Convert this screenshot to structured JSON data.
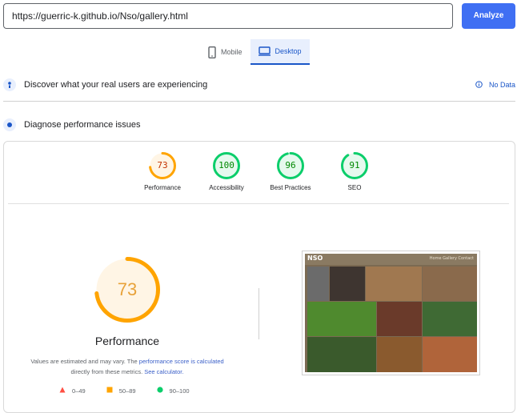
{
  "url_input": {
    "value": "https://guerric-k.github.io/Nso/gallery.html"
  },
  "analyze_button": {
    "label": "Analyze"
  },
  "tabs": [
    {
      "label": "Mobile",
      "active": false
    },
    {
      "label": "Desktop",
      "active": true
    }
  ],
  "field_data": {
    "title": "Discover what your real users are experiencing",
    "status": "No Data"
  },
  "lab_data": {
    "title": "Diagnose performance issues"
  },
  "scores": [
    {
      "label": "Performance",
      "value": "73",
      "color": "#ffa400",
      "fraction": 0.73
    },
    {
      "label": "Accessibility",
      "value": "100",
      "color": "#0cce6b",
      "fraction": 1.0
    },
    {
      "label": "Best Practices",
      "value": "96",
      "color": "#0cce6b",
      "fraction": 0.96
    },
    {
      "label": "SEO",
      "value": "91",
      "color": "#0cce6b",
      "fraction": 0.91
    }
  ],
  "main_score": {
    "value": "73",
    "label": "Performance",
    "fraction": 0.73,
    "color": "#ffa400"
  },
  "note": {
    "prefix": "Values are estimated and may vary. The ",
    "link1": "performance score is calculated",
    "middle": "directly from these metrics. ",
    "link2": "See calculator."
  },
  "legend": [
    {
      "range": "0–49",
      "shape": "triangle",
      "color": "#ff4e42"
    },
    {
      "range": "50–89",
      "shape": "square",
      "color": "#ffa400"
    },
    {
      "range": "90–100",
      "shape": "circle",
      "color": "#0cce6b"
    }
  ],
  "screenshot": {
    "logo": "NSO",
    "nav": "Home Gallery Contact"
  }
}
